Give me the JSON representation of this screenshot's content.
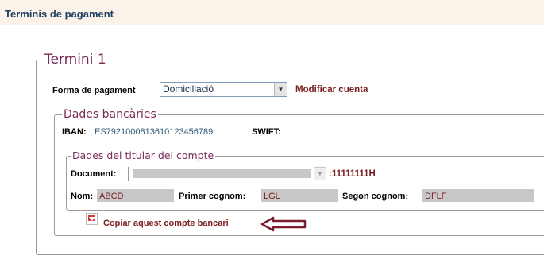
{
  "header": {
    "title": "Terminis de pagament"
  },
  "termini": {
    "legend": "Termini 1",
    "payment_method_label": "Forma de pagament",
    "payment_method_value": "Domiciliació",
    "modify_account_link": "Modificar cuenta"
  },
  "bank": {
    "legend": "Dades bancàries",
    "iban_label": "IBAN:",
    "iban_value": "ES7921000813610123456789",
    "swift_label": "SWIFT:",
    "swift_value": ""
  },
  "holder": {
    "legend": "Dades del titular del compte",
    "document_label": "Document:",
    "document_value": ":11111111H",
    "nom_label": "Nom:",
    "nom_value": "ABCD",
    "cognom1_label": "Primer cognom:",
    "cognom1_value": "LGL",
    "cognom2_label": "Segon cognom:",
    "cognom2_value": "DFLF"
  },
  "actions": {
    "copy_account_link": "Copiar aquest compte bancari"
  },
  "colors": {
    "accent": "#7a1e1e",
    "legend": "#7a2a5a",
    "title": "#1f3f63",
    "header_bg": "#fbf3ea"
  },
  "icons": {
    "copy": "copy-down-arrow-icon",
    "pointer": "pointer-arrow-icon",
    "dropdown": "chevron-down-icon"
  }
}
